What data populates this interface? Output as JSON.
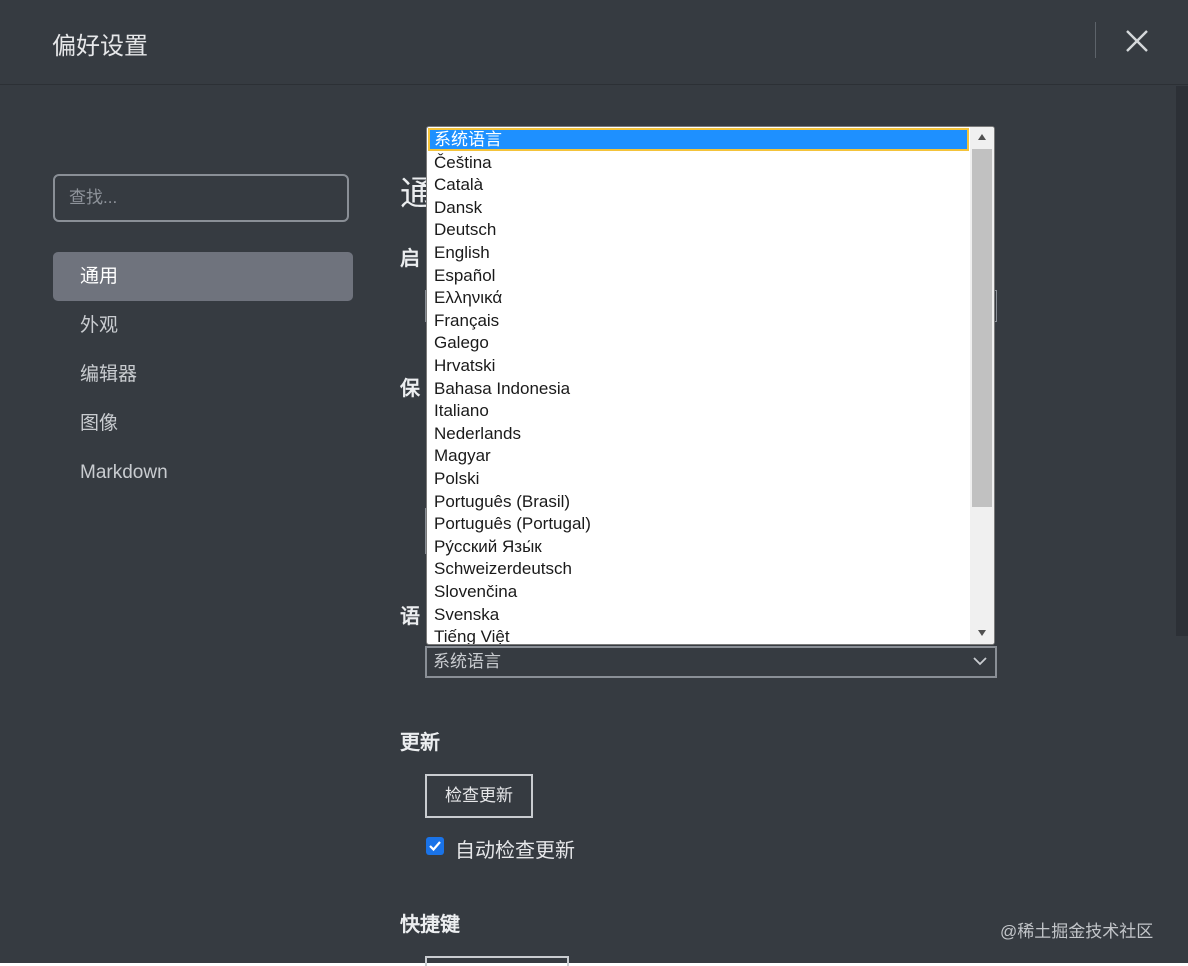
{
  "window": {
    "title": "偏好设置"
  },
  "sidebar": {
    "search_placeholder": "查找...",
    "items": [
      {
        "label": "通用",
        "active": true
      },
      {
        "label": "外观"
      },
      {
        "label": "编辑器"
      },
      {
        "label": "图像"
      },
      {
        "label": "Markdown"
      }
    ]
  },
  "content": {
    "page_heading_partial": "通",
    "section_startup_partial": "启",
    "section_save_partial": "保",
    "section_language_partial": "语",
    "language_select_value": "系统语言",
    "updates_heading": "更新",
    "check_updates_button": "检查更新",
    "auto_check_label": "自动检查更新",
    "auto_check_checked": true,
    "shortcuts_heading": "快捷键"
  },
  "language_dropdown": {
    "options": [
      "系统语言",
      "Čeština",
      "Català",
      "Dansk",
      "Deutsch",
      "English",
      "Español",
      "Ελληνικά",
      "Français",
      "Galego",
      "Hrvatski",
      "Bahasa Indonesia",
      "Italiano",
      "Nederlands",
      "Magyar",
      "Polski",
      "Português (Brasil)",
      "Português (Portugal)",
      "Ру́сский Язы́к",
      "Schweizerdeutsch",
      "Slovenčina",
      "Svenska",
      "Tiếng Việt"
    ],
    "selected_index": 0
  },
  "watermark": "@稀土掘金技术社区",
  "colors": {
    "background": "#363b41",
    "nav_active": "#6f737d",
    "selection": "#1e90ff",
    "checkbox": "#1a73e8"
  },
  "icons": [
    "close-icon",
    "chevron-down-icon",
    "check-icon",
    "scroll-up-arrow-icon",
    "scroll-down-arrow-icon"
  ]
}
